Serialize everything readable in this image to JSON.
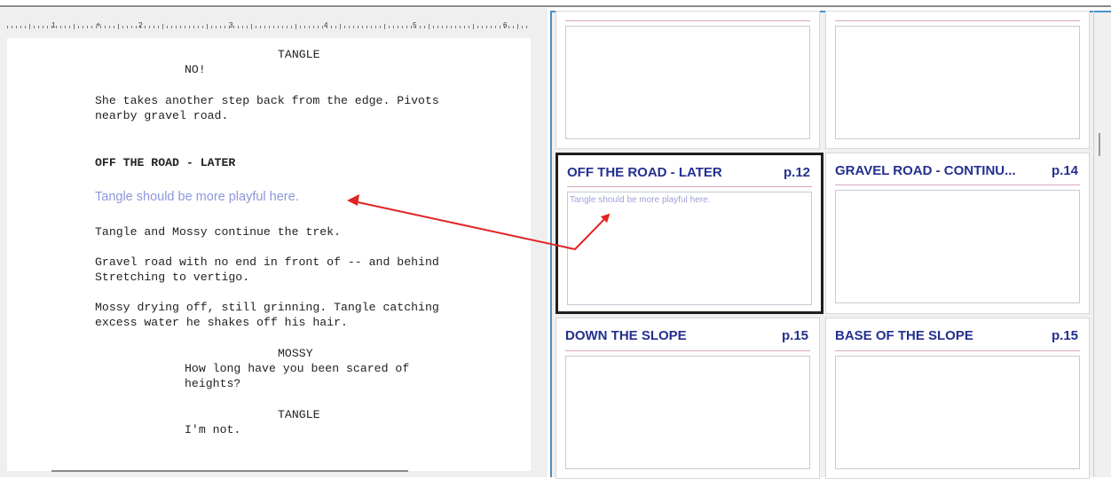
{
  "ruler": {
    "labels": [
      "1",
      "2",
      "3",
      "4",
      "5",
      "6"
    ]
  },
  "script": {
    "lines": [
      {
        "text": "TANGLE",
        "kind": "character"
      },
      {
        "text": "NO!",
        "kind": "dialogue"
      },
      {
        "text": "She takes another step back from the edge. Pivots",
        "kind": "action"
      },
      {
        "text": "nearby gravel road.",
        "kind": "action"
      },
      {
        "text": "OFF THE ROAD - LATER",
        "kind": "scene-heading"
      },
      {
        "text": "Tangle should be more playful here.",
        "kind": "note"
      },
      {
        "text": "Tangle and Mossy continue the trek.",
        "kind": "action"
      },
      {
        "text": "Gravel road with no end in front of -- and behind",
        "kind": "action"
      },
      {
        "text": "Stretching to vertigo.",
        "kind": "action"
      },
      {
        "text": "Mossy drying off, still grinning. Tangle catching",
        "kind": "action"
      },
      {
        "text": "excess water he shakes off his hair.",
        "kind": "action"
      },
      {
        "text": "MOSSY",
        "kind": "character"
      },
      {
        "text": "How long have you been scared of",
        "kind": "dialogue"
      },
      {
        "text": "heights?",
        "kind": "dialogue"
      },
      {
        "text": "TANGLE",
        "kind": "character"
      },
      {
        "text": "I'm not.",
        "kind": "dialogue"
      }
    ]
  },
  "storyboard": {
    "cards": [
      {
        "title": "",
        "page": ""
      },
      {
        "title": "",
        "page": ""
      },
      {
        "title": "OFF THE ROAD - LATER",
        "page": "p.12",
        "note": "Tangle should be more playful here.",
        "selected": true
      },
      {
        "title": "GRAVEL ROAD - CONTINU...",
        "page": "p.14"
      },
      {
        "title": "DOWN THE SLOPE",
        "page": "p.15"
      },
      {
        "title": "BASE OF THE SLOPE",
        "page": "p.15"
      }
    ]
  },
  "colors": {
    "heading": "#23308f",
    "note": "#8e97d9",
    "arrow": "#e02424",
    "selection": "#1e1e1e",
    "accent": "#4a90c8"
  }
}
